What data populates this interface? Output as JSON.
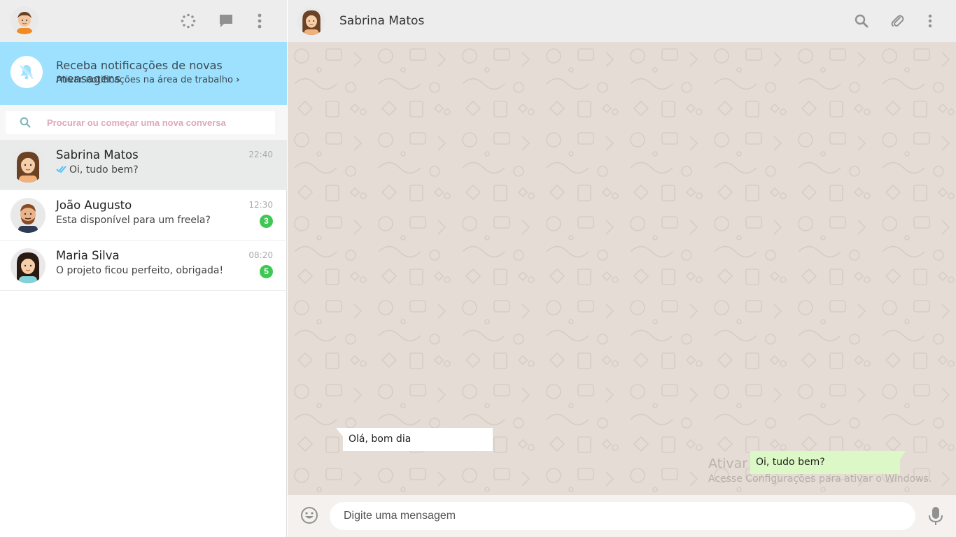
{
  "sidebar": {
    "header": {
      "icons": [
        "status-icon",
        "new-chat-icon",
        "menu-icon"
      ]
    },
    "notification": {
      "title": "Receba notificações de novas mensagens",
      "subtitle": "Ativar notificações na área de trabalho",
      "chevron": "›"
    },
    "search": {
      "placeholder": "Procurar ou começar uma nova conversa"
    },
    "chats": [
      {
        "name": "Sabrina Matos",
        "time": "22:40",
        "preview": "Oi, tudo bem?",
        "read": true
      },
      {
        "name": "João Augusto",
        "time": "12:30",
        "preview": "Esta disponível para um freela?",
        "unread": "3"
      },
      {
        "name": "Maria Silva",
        "time": "08:20",
        "preview": "O projeto ficou perfeito, obrigada!",
        "unread": "5"
      }
    ]
  },
  "conversation": {
    "contact_name": "Sabrina Matos",
    "header_icons": [
      "search-icon",
      "attach-icon",
      "menu-icon"
    ],
    "messages": [
      {
        "direction": "in",
        "text": "Olá, bom dia"
      },
      {
        "direction": "out",
        "text": "Oi, tudo bem?"
      }
    ],
    "composer": {
      "placeholder": "Digite uma mensagem"
    }
  },
  "watermark": {
    "title": "Ativar o Windows",
    "subtitle": "Acesse Configurações para ativar o Windows."
  },
  "colors": {
    "header_bg": "#ededed",
    "notification_bg": "#9de1fe",
    "chat_bg": "#e5ddd5",
    "outgoing_bubble": "#dcf8c6",
    "unread_badge": "#3ec754"
  }
}
